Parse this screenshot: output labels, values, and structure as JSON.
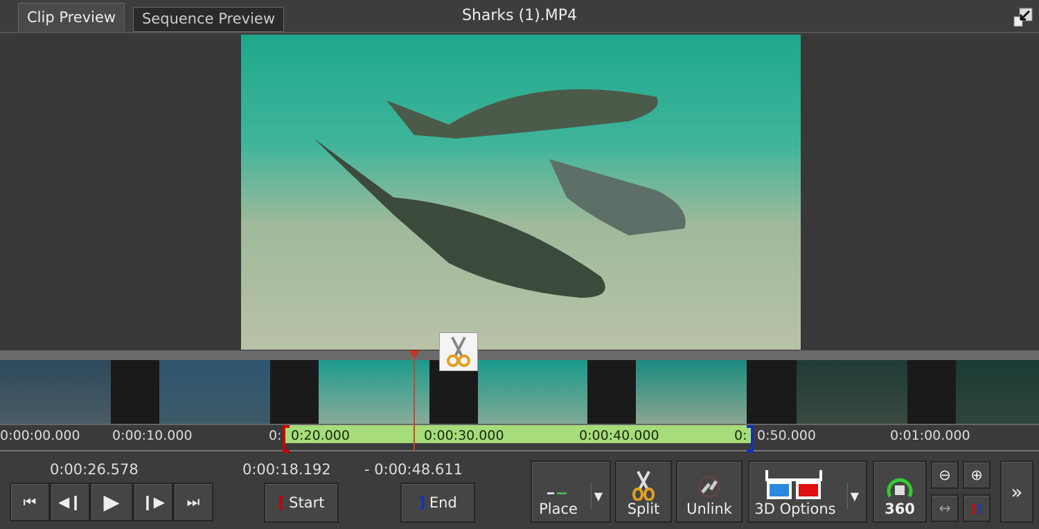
{
  "tabs": [
    {
      "label": "Clip Preview",
      "active": true
    },
    {
      "label": "Sequence Preview",
      "active": false
    }
  ],
  "window_title": "Sharks (1).MP4",
  "ruler": {
    "ticks": [
      "0:00:00.000",
      "0:00:10.000",
      "0:",
      "0:20.000",
      "0:00:30.000",
      "0:00:40.000",
      "0:",
      "0:50.000",
      "0:01:00.000"
    ]
  },
  "playback": {
    "current_time": "0:00:26.578",
    "start_time": "0:00:18.192",
    "end_time": "- 0:00:48.611"
  },
  "buttons": {
    "start": "Start",
    "end": "End",
    "place": "Place",
    "split": "Split",
    "unlink": "Unlink",
    "options_3d": "3D Options",
    "vr360": "360",
    "more": "»"
  },
  "colors": {
    "selection": "#a6dc7a",
    "in_marker": "#cc0000",
    "out_marker": "#1030c0",
    "playhead": "#d04030"
  }
}
